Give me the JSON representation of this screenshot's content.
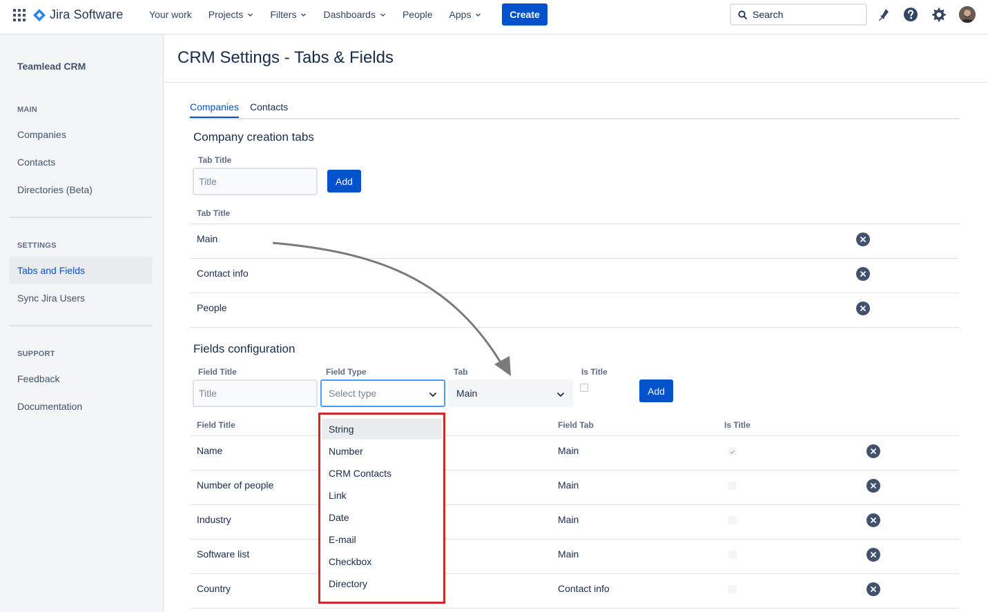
{
  "topnav": {
    "product": "Jira Software",
    "items": [
      {
        "label": "Your work",
        "dropdown": false
      },
      {
        "label": "Projects",
        "dropdown": true
      },
      {
        "label": "Filters",
        "dropdown": true
      },
      {
        "label": "Dashboards",
        "dropdown": true
      },
      {
        "label": "People",
        "dropdown": false
      },
      {
        "label": "Apps",
        "dropdown": true
      }
    ],
    "create_label": "Create",
    "search_placeholder": "Search",
    "icons": [
      "notifications-icon",
      "help-icon",
      "settings-icon",
      "avatar"
    ]
  },
  "sidebar": {
    "title": "Teamlead CRM",
    "sections": [
      {
        "heading": "MAIN",
        "items": [
          "Companies",
          "Contacts",
          "Directories (Beta)"
        ]
      },
      {
        "heading": "SETTINGS",
        "items": [
          "Tabs and Fields",
          "Sync Jira Users"
        ]
      },
      {
        "heading": "SUPPORT",
        "items": [
          "Feedback",
          "Documentation"
        ]
      }
    ],
    "active_item": "Tabs and Fields"
  },
  "page": {
    "title": "CRM Settings - Tabs & Fields",
    "tabs": [
      {
        "label": "Companies",
        "active": true
      },
      {
        "label": "Contacts",
        "active": false
      }
    ]
  },
  "tabs_section": {
    "title": "Company creation tabs",
    "input_label": "Tab Title",
    "input_placeholder": "Title",
    "add_label": "Add",
    "table_header": "Tab Title",
    "rows": [
      "Main",
      "Contact info",
      "People"
    ]
  },
  "fields_section": {
    "title": "Fields configuration",
    "labels": {
      "field_title": "Field Title",
      "field_type": "Field Type",
      "tab": "Tab",
      "is_title": "Is Title"
    },
    "title_placeholder": "Title",
    "type_placeholder": "Select type",
    "tab_value": "Main",
    "add_label": "Add",
    "table_headers": {
      "field_title": "Field Title",
      "field_tab": "Field Tab",
      "is_title": "Is Title"
    },
    "rows": [
      {
        "title": "Name",
        "tab": "Main",
        "is_title": true
      },
      {
        "title": "Number of people",
        "tab": "Main",
        "is_title": false
      },
      {
        "title": "Industry",
        "tab": "Main",
        "is_title": false
      },
      {
        "title": "Software list",
        "tab": "Main",
        "is_title": false
      },
      {
        "title": "Country",
        "tab": "Contact info",
        "is_title": false
      }
    ]
  },
  "type_dropdown": {
    "options": [
      "String",
      "Number",
      "CRM Contacts",
      "Link",
      "Date",
      "E-mail",
      "Checkbox",
      "Directory"
    ],
    "highlighted": "String",
    "highlight_color": "#D0272A"
  },
  "colors": {
    "primary": "#0052CC",
    "sidebar_bg": "#F4F5F7",
    "text": "#172B4D"
  }
}
